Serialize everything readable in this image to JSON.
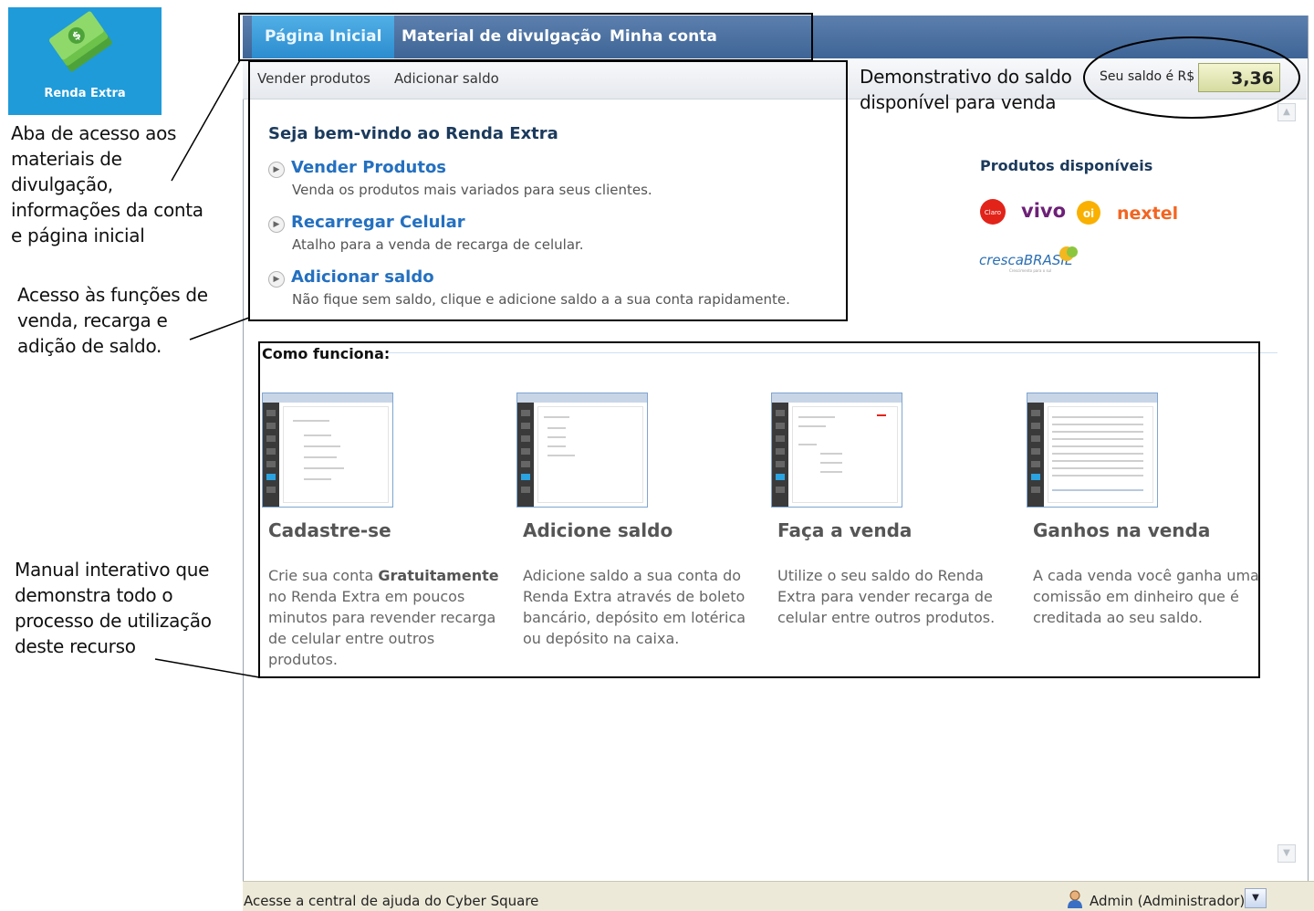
{
  "logo": {
    "label": "Renda Extra"
  },
  "annotations": {
    "tabs": [
      "Aba de acesso aos",
      "materiais de",
      "divulgação,",
      "informações da conta",
      "e página inicial"
    ],
    "functions": [
      "Acesso às funções de",
      "venda, recarga e",
      "adição de saldo."
    ],
    "manual": [
      "Manual interativo que",
      "demonstra todo o",
      "processo de utilização",
      "deste recurso"
    ],
    "balance": [
      "Demonstrativo do saldo",
      "disponível para venda"
    ]
  },
  "tabs": [
    "Página Inicial",
    "Material de divulgação",
    "Minha conta"
  ],
  "subnav": [
    "Vender produtos",
    "Adicionar saldo"
  ],
  "balance": {
    "label": "Seu saldo é R$",
    "value": "3,36"
  },
  "welcome": {
    "title": "Seja bem-vindo ao Renda Extra",
    "items": [
      {
        "title": "Vender Produtos",
        "desc": "Venda os produtos mais variados para seus clientes."
      },
      {
        "title": "Recarregar Celular",
        "desc": "Atalho para a venda de recarga de celular."
      },
      {
        "title": "Adicionar saldo",
        "desc": "Não fique sem saldo, clique e adicione saldo a a sua conta rapidamente."
      }
    ]
  },
  "products": {
    "title": "Produtos disponíveis",
    "logos": {
      "claro": "Claro",
      "vivo": "vivo",
      "oi": "oi",
      "nextel": "nextel",
      "cresca": "crescaBRASIL",
      "cresca_tagline": "Crescimento para o sul"
    }
  },
  "how": {
    "title": "Como funciona:",
    "steps": [
      {
        "title": "Cadastre-se",
        "desc_lines": [
          "Crie sua conta ",
          "no Renda Extra em poucos",
          "minutos para revender recarga",
          "de celular entre outros",
          "produtos."
        ],
        "strong": "Gratuitamente"
      },
      {
        "title": "Adicione saldo",
        "desc_lines": [
          "Adicione saldo a sua conta do",
          "Renda Extra através de boleto",
          "bancário, depósito em lotérica",
          "ou depósito na caixa."
        ]
      },
      {
        "title": "Faça a venda",
        "desc_lines": [
          "Utilize o seu saldo do Renda",
          "Extra para vender recarga de",
          "celular entre outros produtos."
        ]
      },
      {
        "title": "Ganhos na venda",
        "desc_lines": [
          "A cada venda você ganha uma",
          "comissão em dinheiro que é",
          "creditada ao seu saldo."
        ]
      }
    ]
  },
  "status": {
    "help": "Acesse a central de ajuda do Cyber Square",
    "user": "Admin (Administrador)"
  },
  "colors": {
    "topbar": "#3e6596",
    "active_tab": "#2b8ccf",
    "link": "#2470c0",
    "logo_bg": "#1f9bd9"
  }
}
